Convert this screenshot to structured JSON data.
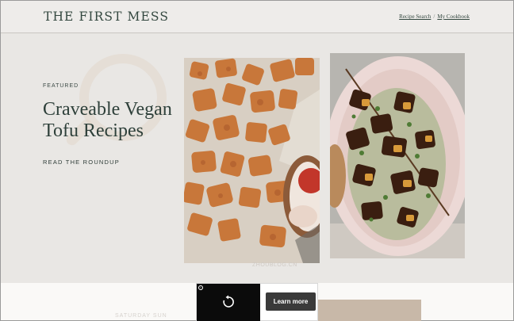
{
  "header": {
    "logo": "THE FIRST MESS",
    "links": [
      {
        "label": "Recipe Search"
      },
      {
        "label": "My Cookbook"
      }
    ],
    "separator": "/"
  },
  "featured": {
    "kicker": "FEATURED",
    "title": "Craveable Vegan Tofu Recipes",
    "cta": "READ THE ROUNDUP"
  },
  "images": {
    "photo_left": "crispy-tofu-bites-photo",
    "photo_right": "tofu-skewers-platter-photo",
    "watermark": "ZHOUBLOG.CN"
  },
  "lower": {
    "section_label": "SATURDAY SUN"
  },
  "ad": {
    "button_label": "Learn more",
    "info_icon": "i",
    "replay_icon": "replay-icon"
  },
  "colors": {
    "background": "#e9e7e4",
    "brand_text": "#33473f",
    "ad_button": "#3a3a3a"
  }
}
